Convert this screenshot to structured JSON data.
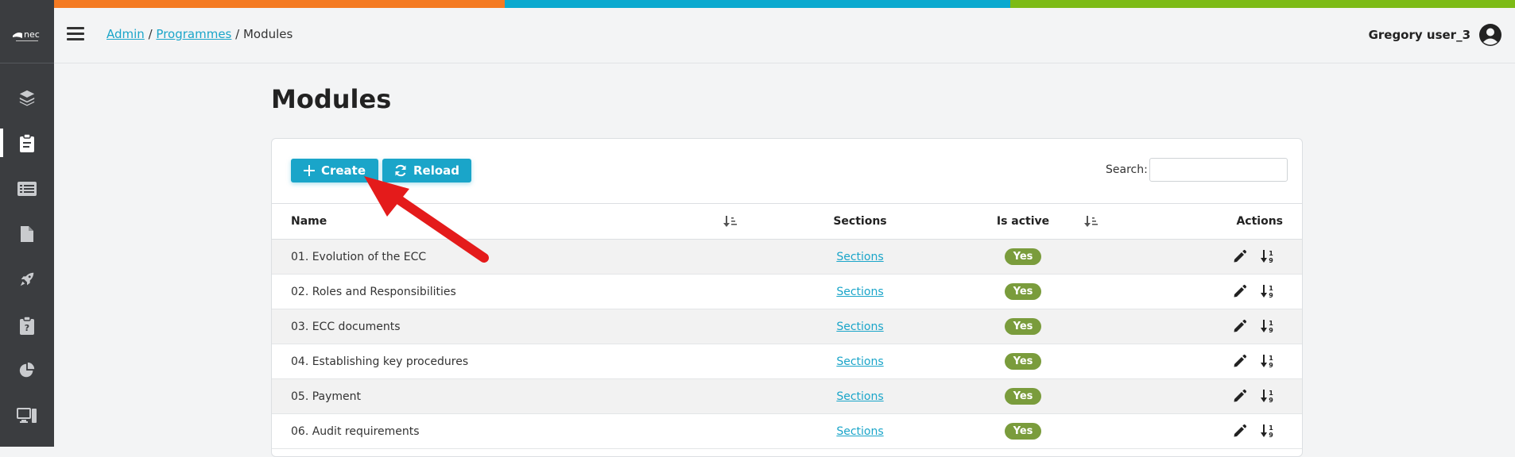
{
  "colors": {
    "stripe": [
      "#f47a22",
      "#0aa9cf",
      "#7cbb16"
    ],
    "accent": "#1aa5c9",
    "badge": "#7a9c3c",
    "sidebar": "#3b3d40",
    "annotation_arrow": "#e41b1b"
  },
  "sidebar": {
    "logo_icon": "nec-logo-icon",
    "items": [
      {
        "icon": "layers-icon",
        "active": false
      },
      {
        "icon": "clipboard-icon",
        "active": true
      },
      {
        "icon": "list-icon",
        "active": false
      },
      {
        "icon": "file-icon",
        "active": false
      },
      {
        "icon": "rocket-icon",
        "active": false
      },
      {
        "icon": "clipboard-question-icon",
        "active": false
      },
      {
        "icon": "pie-chart-icon",
        "active": false
      },
      {
        "icon": "desktop-icon",
        "active": false
      }
    ]
  },
  "header": {
    "breadcrumb": [
      {
        "label": "Admin",
        "link": true
      },
      {
        "label": "Programmes",
        "link": true
      },
      {
        "label": "Modules",
        "link": false
      }
    ],
    "user_name": "Gregory user_3",
    "user_icon": "user-circle-icon"
  },
  "page": {
    "title": "Modules"
  },
  "toolbar": {
    "create_label": "Create",
    "reload_label": "Reload",
    "search_label": "Search:",
    "search_value": ""
  },
  "table": {
    "columns": [
      "Name",
      "Sections",
      "Is active",
      "Actions"
    ],
    "rows": [
      {
        "name": "01. Evolution of the ECC",
        "sections": "Sections",
        "active": "Yes"
      },
      {
        "name": "02. Roles and Responsibilities",
        "sections": "Sections",
        "active": "Yes"
      },
      {
        "name": "03. ECC documents",
        "sections": "Sections",
        "active": "Yes"
      },
      {
        "name": "04. Establishing key procedures",
        "sections": "Sections",
        "active": "Yes"
      },
      {
        "name": "05. Payment",
        "sections": "Sections",
        "active": "Yes"
      },
      {
        "name": "06. Audit requirements",
        "sections": "Sections",
        "active": "Yes"
      }
    ]
  }
}
